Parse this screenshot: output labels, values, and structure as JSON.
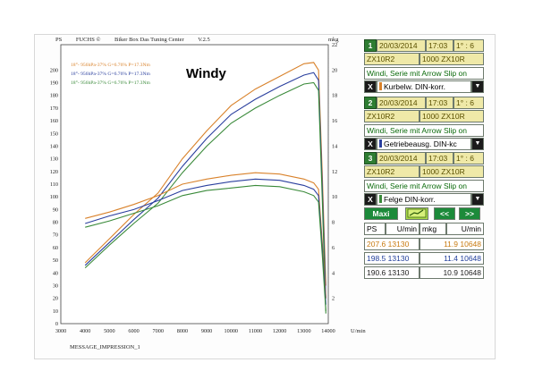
{
  "header": {
    "ps_label": "PS",
    "brand": "FUCHS ©",
    "program": "Biker Box Das Tuning Center",
    "version": "V.2.5",
    "mkg_label": "mkg"
  },
  "legend": [
    {
      "text": "18°- 956hPa-37% G=6.76% P=17.3Nm",
      "color": "#d9822b"
    },
    {
      "text": "18°- 956hPa-37% G=6.76% P=17.3Nm",
      "color": "#2a3f9e"
    },
    {
      "text": "18°- 956hPa-37% G=6.76% P=17.3Nm",
      "color": "#3a8a3a"
    }
  ],
  "annotation": "Windy",
  "message": "MESSAGE_IMPRESSION_1",
  "panel": {
    "runs": [
      {
        "index": "1",
        "date": "20/03/2014",
        "time": "17:03",
        "gear": "1° : 6",
        "model": "ZX10R2",
        "model2": "1000 ZX10R",
        "desc": "Windi, Serie mit Arrow Slip on",
        "correction": "Kurbelw. DIN-korr.",
        "color": "#d9822b"
      },
      {
        "index": "2",
        "date": "20/03/2014",
        "time": "17:03",
        "gear": "1° : 6",
        "model": "ZX10R2",
        "model2": "1000 ZX10R",
        "desc": "Windi, Serie mit Arrow Slip on",
        "correction": "Getriebeausg. DIN-kc",
        "color": "#2a3f9e"
      },
      {
        "index": "3",
        "date": "20/03/2014",
        "time": "17:03",
        "gear": "1° : 6",
        "model": "ZX10R2",
        "model2": "1000 ZX10R",
        "desc": "Windi, Serie mit Arrow Slip on",
        "correction": "Felge DIN-korr.",
        "color": "#3a8a3a"
      }
    ],
    "x_label": "X",
    "dropdown_arrow": "▼",
    "maxi_label": "Maxi",
    "prev_label": "<<",
    "next_label": ">>",
    "table_headers": [
      "PS",
      "U/min",
      "mkg",
      "U/min"
    ],
    "results": [
      {
        "ps": "207.6",
        "ps_rpm": "13130",
        "mkg": "11.9",
        "mkg_rpm": "10648",
        "color": "#c87a10"
      },
      {
        "ps": "198.5",
        "ps_rpm": "13130",
        "mkg": "11.4",
        "mkg_rpm": "10648",
        "color": "#1f3d9a"
      },
      {
        "ps": "190.6",
        "ps_rpm": "13130",
        "mkg": "10.9",
        "mkg_rpm": "10648",
        "color": "#222222"
      }
    ],
    "icon": "graph-icon"
  },
  "chart_data": {
    "type": "line",
    "xlabel": "U/min",
    "ylabel": "PS",
    "y2label": "mkg",
    "xlim": [
      3000,
      14000
    ],
    "ylim": [
      0,
      220
    ],
    "y2lim": [
      0,
      22
    ],
    "xticks": [
      3000,
      4000,
      5000,
      6000,
      7000,
      8000,
      9000,
      10000,
      11000,
      12000,
      13000,
      14000
    ],
    "yticks": [
      0,
      10,
      20,
      30,
      40,
      50,
      60,
      70,
      80,
      90,
      100,
      110,
      120,
      130,
      140,
      150,
      160,
      170,
      180,
      190,
      200
    ],
    "y2ticks": [
      2,
      4,
      6,
      8,
      10,
      12,
      14,
      16,
      18,
      20,
      22
    ],
    "grid": true,
    "series": [
      {
        "name": "PS 1",
        "axis": "left",
        "color": "#d9822b",
        "x": [
          4000,
          5000,
          6000,
          7000,
          8000,
          9000,
          10000,
          11000,
          12000,
          13000,
          13400,
          13600,
          13750,
          13900
        ],
        "y": [
          48,
          67,
          86,
          103,
          130,
          152,
          172,
          185,
          195,
          205,
          206,
          200,
          120,
          30
        ]
      },
      {
        "name": "PS 2",
        "axis": "left",
        "color": "#2a3f9e",
        "x": [
          4000,
          5000,
          6000,
          7000,
          8000,
          9000,
          10000,
          11000,
          12000,
          13000,
          13400,
          13600,
          13750,
          13900
        ],
        "y": [
          46,
          64,
          82,
          99,
          124,
          146,
          165,
          177,
          187,
          196,
          198,
          192,
          110,
          20
        ]
      },
      {
        "name": "PS 3",
        "axis": "left",
        "color": "#3a8a3a",
        "x": [
          4000,
          5000,
          6000,
          7000,
          8000,
          9000,
          10000,
          11000,
          12000,
          13000,
          13400,
          13600,
          13750,
          13900
        ],
        "y": [
          44,
          62,
          79,
          95,
          119,
          140,
          158,
          170,
          180,
          189,
          190,
          184,
          100,
          8
        ]
      },
      {
        "name": "mkg 1",
        "axis": "right",
        "color": "#d9822b",
        "x": [
          4000,
          5000,
          6000,
          7000,
          8000,
          9000,
          10000,
          11000,
          12000,
          13000,
          13400,
          13600,
          13750,
          13900
        ],
        "y": [
          8.3,
          8.8,
          9.4,
          10.1,
          11.0,
          11.4,
          11.7,
          11.9,
          11.8,
          11.4,
          11.1,
          10.6,
          6.5,
          2.0
        ]
      },
      {
        "name": "mkg 2",
        "axis": "right",
        "color": "#2a3f9e",
        "x": [
          4000,
          5000,
          6000,
          7000,
          8000,
          9000,
          10000,
          11000,
          12000,
          13000,
          13400,
          13600,
          13750,
          13900
        ],
        "y": [
          7.9,
          8.5,
          9.0,
          9.7,
          10.5,
          10.9,
          11.2,
          11.4,
          11.3,
          10.9,
          10.6,
          10.1,
          6.0,
          1.5
        ]
      },
      {
        "name": "mkg 3",
        "axis": "right",
        "color": "#3a8a3a",
        "x": [
          4000,
          5000,
          6000,
          7000,
          8000,
          9000,
          10000,
          11000,
          12000,
          13000,
          13400,
          13600,
          13750,
          13900
        ],
        "y": [
          7.6,
          8.1,
          8.7,
          9.3,
          10.1,
          10.5,
          10.7,
          10.9,
          10.8,
          10.4,
          10.1,
          9.6,
          5.5,
          1.0
        ]
      }
    ]
  }
}
